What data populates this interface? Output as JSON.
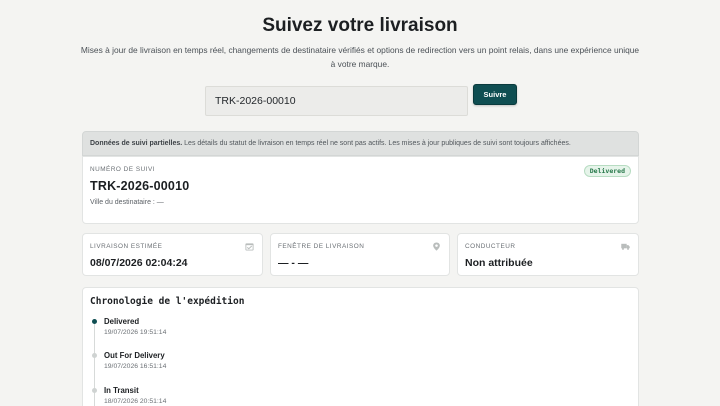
{
  "hero": {
    "title": "Suivez votre livraison",
    "subtitle": "Mises à jour de livraison en temps réel, changements de destinataire vérifiés et options de redirection vers un point relais, dans une expérience unique à votre marque."
  },
  "search": {
    "value": "TRK-2026-00010",
    "button_label": "Suivre"
  },
  "notice": {
    "bold": "Données de suivi partielles.",
    "text": "Les détails du statut de livraison en temps réel ne sont pas actifs. Les mises à jour publiques de suivi sont toujours affichées."
  },
  "tracking": {
    "label": "NUMÉRO DE SUIVI",
    "number": "TRK-2026-00010",
    "destination": "Ville du destinataire : —",
    "status": "Delivered"
  },
  "info_cards": [
    {
      "label": "LIVRAISON ESTIMÉE",
      "value": "08/07/2026 02:04:24",
      "icon": "calendar-icon"
    },
    {
      "label": "FENÊTRE DE LIVRAISON",
      "value": "— - —",
      "icon": "location-pin-icon"
    },
    {
      "label": "CONDUCTEUR",
      "value": "Non attribuée",
      "icon": "truck-icon"
    }
  ],
  "timeline": {
    "title": "Chronologie de l'expédition",
    "events": [
      {
        "status": "Delivered",
        "time": "19/07/2026 19:51:14"
      },
      {
        "status": "Out For Delivery",
        "time": "19/07/2026 16:51:14"
      },
      {
        "status": "In Transit",
        "time": "18/07/2026 20:51:14"
      }
    ]
  },
  "colors": {
    "accent": "#0f4e52",
    "background": "#f4f4f2",
    "delivered_badge": "#26784a"
  }
}
